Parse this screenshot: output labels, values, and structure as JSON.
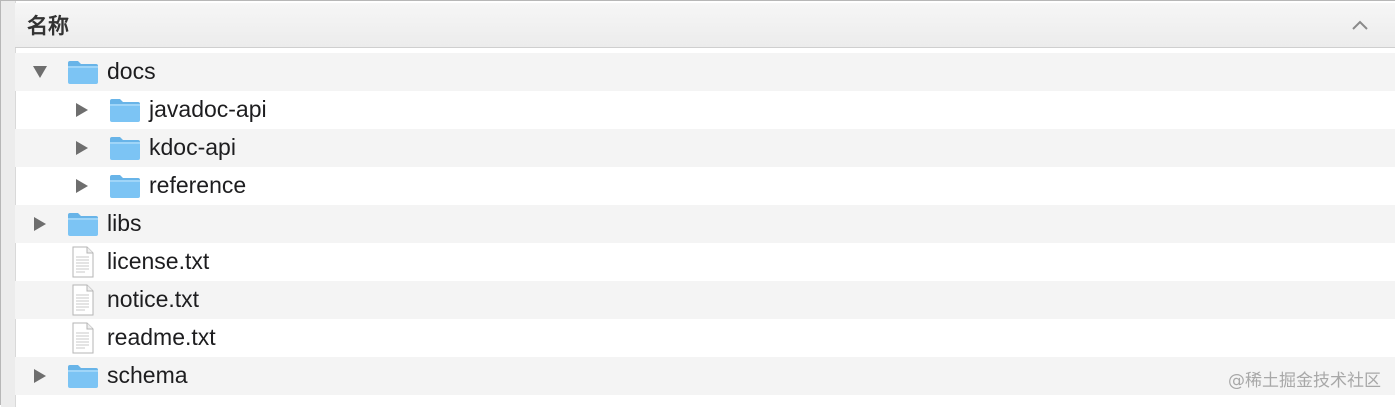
{
  "header": {
    "column_name": "名称"
  },
  "items": [
    {
      "name": "docs",
      "type": "folder",
      "level": 0,
      "expanded": true,
      "icon": "folder-icon"
    },
    {
      "name": "javadoc-api",
      "type": "folder",
      "level": 1,
      "expanded": false,
      "icon": "folder-icon"
    },
    {
      "name": "kdoc-api",
      "type": "folder",
      "level": 1,
      "expanded": false,
      "icon": "folder-icon"
    },
    {
      "name": "reference",
      "type": "folder",
      "level": 1,
      "expanded": false,
      "icon": "folder-icon"
    },
    {
      "name": "libs",
      "type": "folder",
      "level": 0,
      "expanded": false,
      "icon": "folder-icon"
    },
    {
      "name": "license.txt",
      "type": "file",
      "level": 0,
      "icon": "text-file-icon"
    },
    {
      "name": "notice.txt",
      "type": "file",
      "level": 0,
      "icon": "text-file-icon"
    },
    {
      "name": "readme.txt",
      "type": "file",
      "level": 0,
      "icon": "text-file-icon"
    },
    {
      "name": "schema",
      "type": "folder",
      "level": 0,
      "expanded": false,
      "icon": "folder-icon"
    }
  ],
  "watermark": "@稀土掘金技术社区",
  "colors": {
    "folder": "#7cc4f4",
    "folder_tab": "#68b4e8",
    "alt_row": "#f4f4f4",
    "disclosure": "#6e6e6e"
  }
}
